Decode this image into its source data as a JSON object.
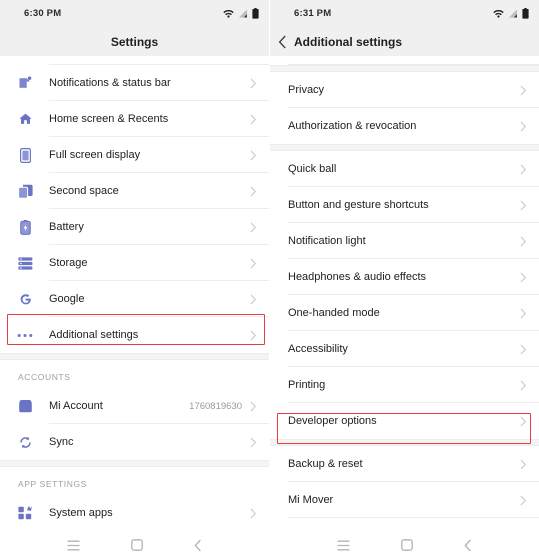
{
  "left_screen": {
    "status": {
      "time": "6:30 PM",
      "icons": [
        "wifi-icon",
        "signal-icon",
        "battery-icon"
      ]
    },
    "header": {
      "title": "Settings"
    },
    "items": [
      {
        "label": "Notifications & status bar",
        "icon": "notifications-icon",
        "value": ""
      },
      {
        "label": "Home screen & Recents",
        "icon": "home-icon",
        "value": ""
      },
      {
        "label": "Full screen display",
        "icon": "fullscreen-icon",
        "value": ""
      },
      {
        "label": "Second space",
        "icon": "second-space-icon",
        "value": ""
      },
      {
        "label": "Battery",
        "icon": "battery-icon",
        "value": ""
      },
      {
        "label": "Storage",
        "icon": "storage-icon",
        "value": ""
      },
      {
        "label": "Google",
        "icon": "google-icon",
        "value": ""
      },
      {
        "label": "Additional settings",
        "icon": "more-dots-icon",
        "value": ""
      }
    ],
    "accounts_section": {
      "header": "ACCOUNTS",
      "items": [
        {
          "label": "Mi Account",
          "icon": "mi-account-icon",
          "value": "1760819630"
        },
        {
          "label": "Sync",
          "icon": "sync-icon",
          "value": ""
        }
      ]
    },
    "app_settings_section": {
      "header": "APP SETTINGS",
      "items": [
        {
          "label": "System apps",
          "icon": "system-apps-icon",
          "value": ""
        }
      ]
    },
    "highlighted_item": "Additional settings",
    "highlight_color": "#ec3b3b",
    "navbar": [
      "menu-icon",
      "home-square-icon",
      "back-chevron-icon"
    ]
  },
  "right_screen": {
    "status": {
      "time": "6:31 PM",
      "icons": [
        "wifi-icon",
        "signal-icon",
        "battery-icon"
      ]
    },
    "header": {
      "title": "Additional settings",
      "back": "back-chevron-icon"
    },
    "items": [
      {
        "label": "Privacy"
      },
      {
        "label": "Authorization & revocation"
      },
      {
        "label": "Quick ball"
      },
      {
        "label": "Button and gesture shortcuts"
      },
      {
        "label": "Notification light"
      },
      {
        "label": "Headphones & audio effects"
      },
      {
        "label": "One-handed mode"
      },
      {
        "label": "Accessibility"
      },
      {
        "label": "Printing"
      },
      {
        "label": "Developer options"
      },
      {
        "label": "Backup & reset"
      },
      {
        "label": "Mi Mover"
      }
    ],
    "highlighted_item": "Developer options",
    "highlight_color": "#ec3b3b",
    "navbar": [
      "menu-icon",
      "home-square-icon",
      "back-chevron-icon"
    ]
  },
  "theme": {
    "icon_color": "#6b74c4",
    "text_color": "#212121",
    "header_bg": "#f0f0f0"
  }
}
